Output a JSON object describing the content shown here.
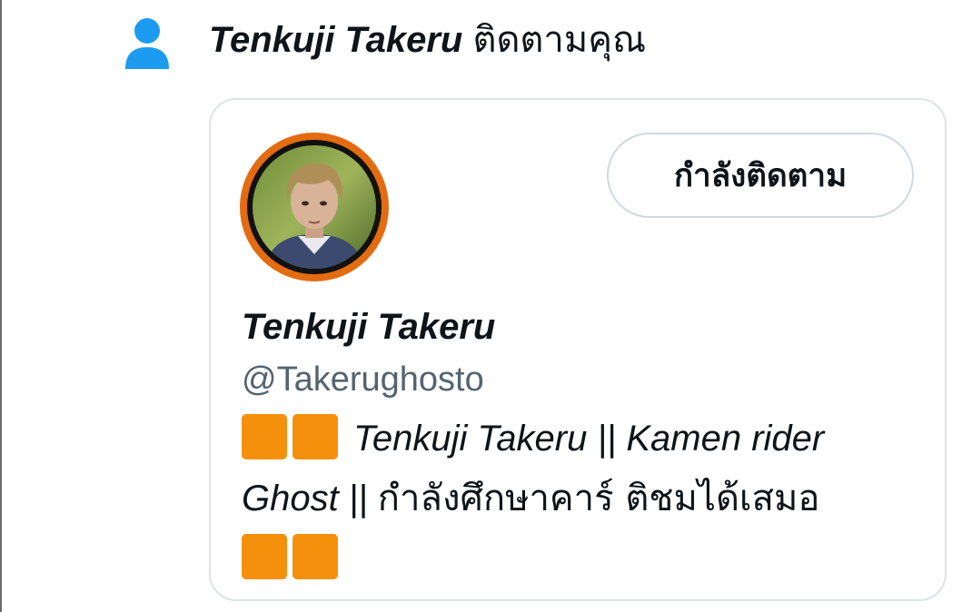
{
  "notification": {
    "icon": "person-icon",
    "icon_color": "#1d9bf0",
    "name": "Tenkuji Takeru",
    "action": "ติดตามคุณ"
  },
  "card": {
    "follow_button_label": "กำลังติดตาม",
    "display_name": "Tenkuji Takeru",
    "handle": "@Takerughosto",
    "bio": {
      "line1_text": "Tenkuji Takeru || Kamen rider",
      "line2_latin": "Ghost ||",
      "line2_thai": "กำลังศึกษาคาร์ ติชมได้เสมอ"
    },
    "accent_square_color": "#f4900c",
    "avatar_ring_color": "#e36b10"
  }
}
